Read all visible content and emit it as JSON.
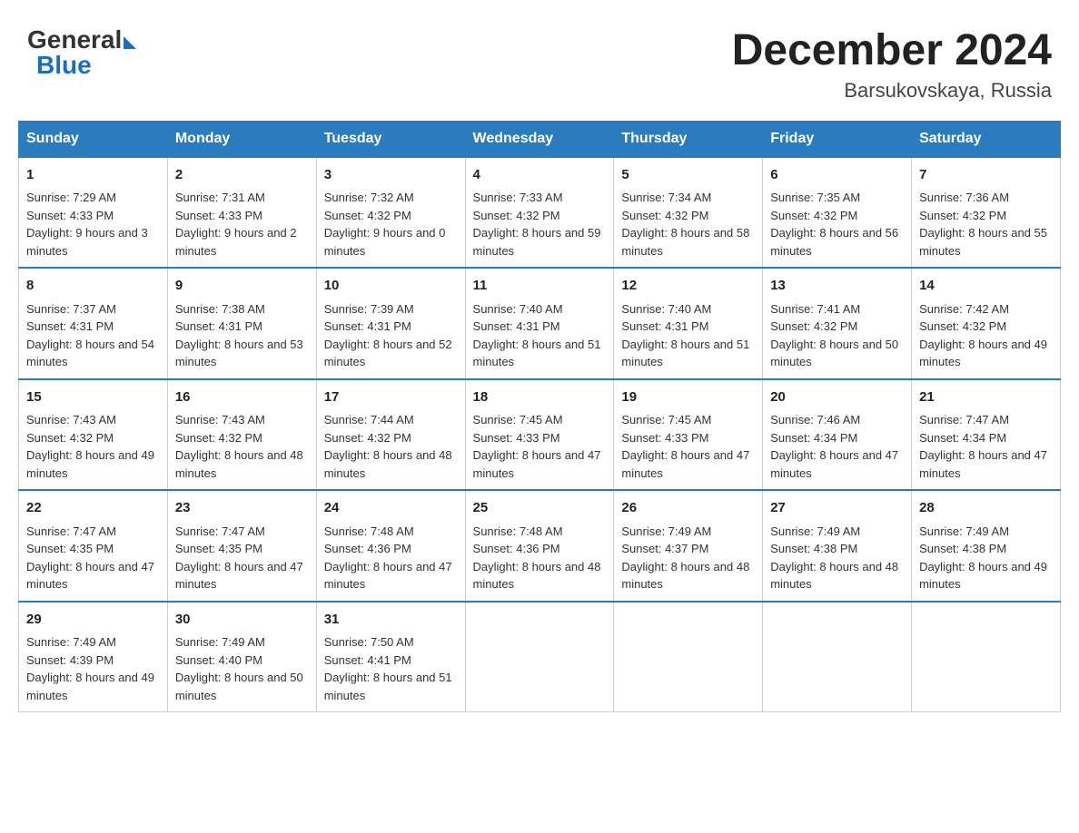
{
  "header": {
    "logo_general": "General",
    "logo_blue": "Blue",
    "title": "December 2024",
    "subtitle": "Barsukovskaya, Russia"
  },
  "days_of_week": [
    "Sunday",
    "Monday",
    "Tuesday",
    "Wednesday",
    "Thursday",
    "Friday",
    "Saturday"
  ],
  "weeks": [
    [
      {
        "day": "1",
        "sunrise": "7:29 AM",
        "sunset": "4:33 PM",
        "daylight": "9 hours and 3 minutes."
      },
      {
        "day": "2",
        "sunrise": "7:31 AM",
        "sunset": "4:33 PM",
        "daylight": "9 hours and 2 minutes."
      },
      {
        "day": "3",
        "sunrise": "7:32 AM",
        "sunset": "4:32 PM",
        "daylight": "9 hours and 0 minutes."
      },
      {
        "day": "4",
        "sunrise": "7:33 AM",
        "sunset": "4:32 PM",
        "daylight": "8 hours and 59 minutes."
      },
      {
        "day": "5",
        "sunrise": "7:34 AM",
        "sunset": "4:32 PM",
        "daylight": "8 hours and 58 minutes."
      },
      {
        "day": "6",
        "sunrise": "7:35 AM",
        "sunset": "4:32 PM",
        "daylight": "8 hours and 56 minutes."
      },
      {
        "day": "7",
        "sunrise": "7:36 AM",
        "sunset": "4:32 PM",
        "daylight": "8 hours and 55 minutes."
      }
    ],
    [
      {
        "day": "8",
        "sunrise": "7:37 AM",
        "sunset": "4:31 PM",
        "daylight": "8 hours and 54 minutes."
      },
      {
        "day": "9",
        "sunrise": "7:38 AM",
        "sunset": "4:31 PM",
        "daylight": "8 hours and 53 minutes."
      },
      {
        "day": "10",
        "sunrise": "7:39 AM",
        "sunset": "4:31 PM",
        "daylight": "8 hours and 52 minutes."
      },
      {
        "day": "11",
        "sunrise": "7:40 AM",
        "sunset": "4:31 PM",
        "daylight": "8 hours and 51 minutes."
      },
      {
        "day": "12",
        "sunrise": "7:40 AM",
        "sunset": "4:31 PM",
        "daylight": "8 hours and 51 minutes."
      },
      {
        "day": "13",
        "sunrise": "7:41 AM",
        "sunset": "4:32 PM",
        "daylight": "8 hours and 50 minutes."
      },
      {
        "day": "14",
        "sunrise": "7:42 AM",
        "sunset": "4:32 PM",
        "daylight": "8 hours and 49 minutes."
      }
    ],
    [
      {
        "day": "15",
        "sunrise": "7:43 AM",
        "sunset": "4:32 PM",
        "daylight": "8 hours and 49 minutes."
      },
      {
        "day": "16",
        "sunrise": "7:43 AM",
        "sunset": "4:32 PM",
        "daylight": "8 hours and 48 minutes."
      },
      {
        "day": "17",
        "sunrise": "7:44 AM",
        "sunset": "4:32 PM",
        "daylight": "8 hours and 48 minutes."
      },
      {
        "day": "18",
        "sunrise": "7:45 AM",
        "sunset": "4:33 PM",
        "daylight": "8 hours and 47 minutes."
      },
      {
        "day": "19",
        "sunrise": "7:45 AM",
        "sunset": "4:33 PM",
        "daylight": "8 hours and 47 minutes."
      },
      {
        "day": "20",
        "sunrise": "7:46 AM",
        "sunset": "4:34 PM",
        "daylight": "8 hours and 47 minutes."
      },
      {
        "day": "21",
        "sunrise": "7:47 AM",
        "sunset": "4:34 PM",
        "daylight": "8 hours and 47 minutes."
      }
    ],
    [
      {
        "day": "22",
        "sunrise": "7:47 AM",
        "sunset": "4:35 PM",
        "daylight": "8 hours and 47 minutes."
      },
      {
        "day": "23",
        "sunrise": "7:47 AM",
        "sunset": "4:35 PM",
        "daylight": "8 hours and 47 minutes."
      },
      {
        "day": "24",
        "sunrise": "7:48 AM",
        "sunset": "4:36 PM",
        "daylight": "8 hours and 47 minutes."
      },
      {
        "day": "25",
        "sunrise": "7:48 AM",
        "sunset": "4:36 PM",
        "daylight": "8 hours and 48 minutes."
      },
      {
        "day": "26",
        "sunrise": "7:49 AM",
        "sunset": "4:37 PM",
        "daylight": "8 hours and 48 minutes."
      },
      {
        "day": "27",
        "sunrise": "7:49 AM",
        "sunset": "4:38 PM",
        "daylight": "8 hours and 48 minutes."
      },
      {
        "day": "28",
        "sunrise": "7:49 AM",
        "sunset": "4:38 PM",
        "daylight": "8 hours and 49 minutes."
      }
    ],
    [
      {
        "day": "29",
        "sunrise": "7:49 AM",
        "sunset": "4:39 PM",
        "daylight": "8 hours and 49 minutes."
      },
      {
        "day": "30",
        "sunrise": "7:49 AM",
        "sunset": "4:40 PM",
        "daylight": "8 hours and 50 minutes."
      },
      {
        "day": "31",
        "sunrise": "7:50 AM",
        "sunset": "4:41 PM",
        "daylight": "8 hours and 51 minutes."
      },
      null,
      null,
      null,
      null
    ]
  ]
}
